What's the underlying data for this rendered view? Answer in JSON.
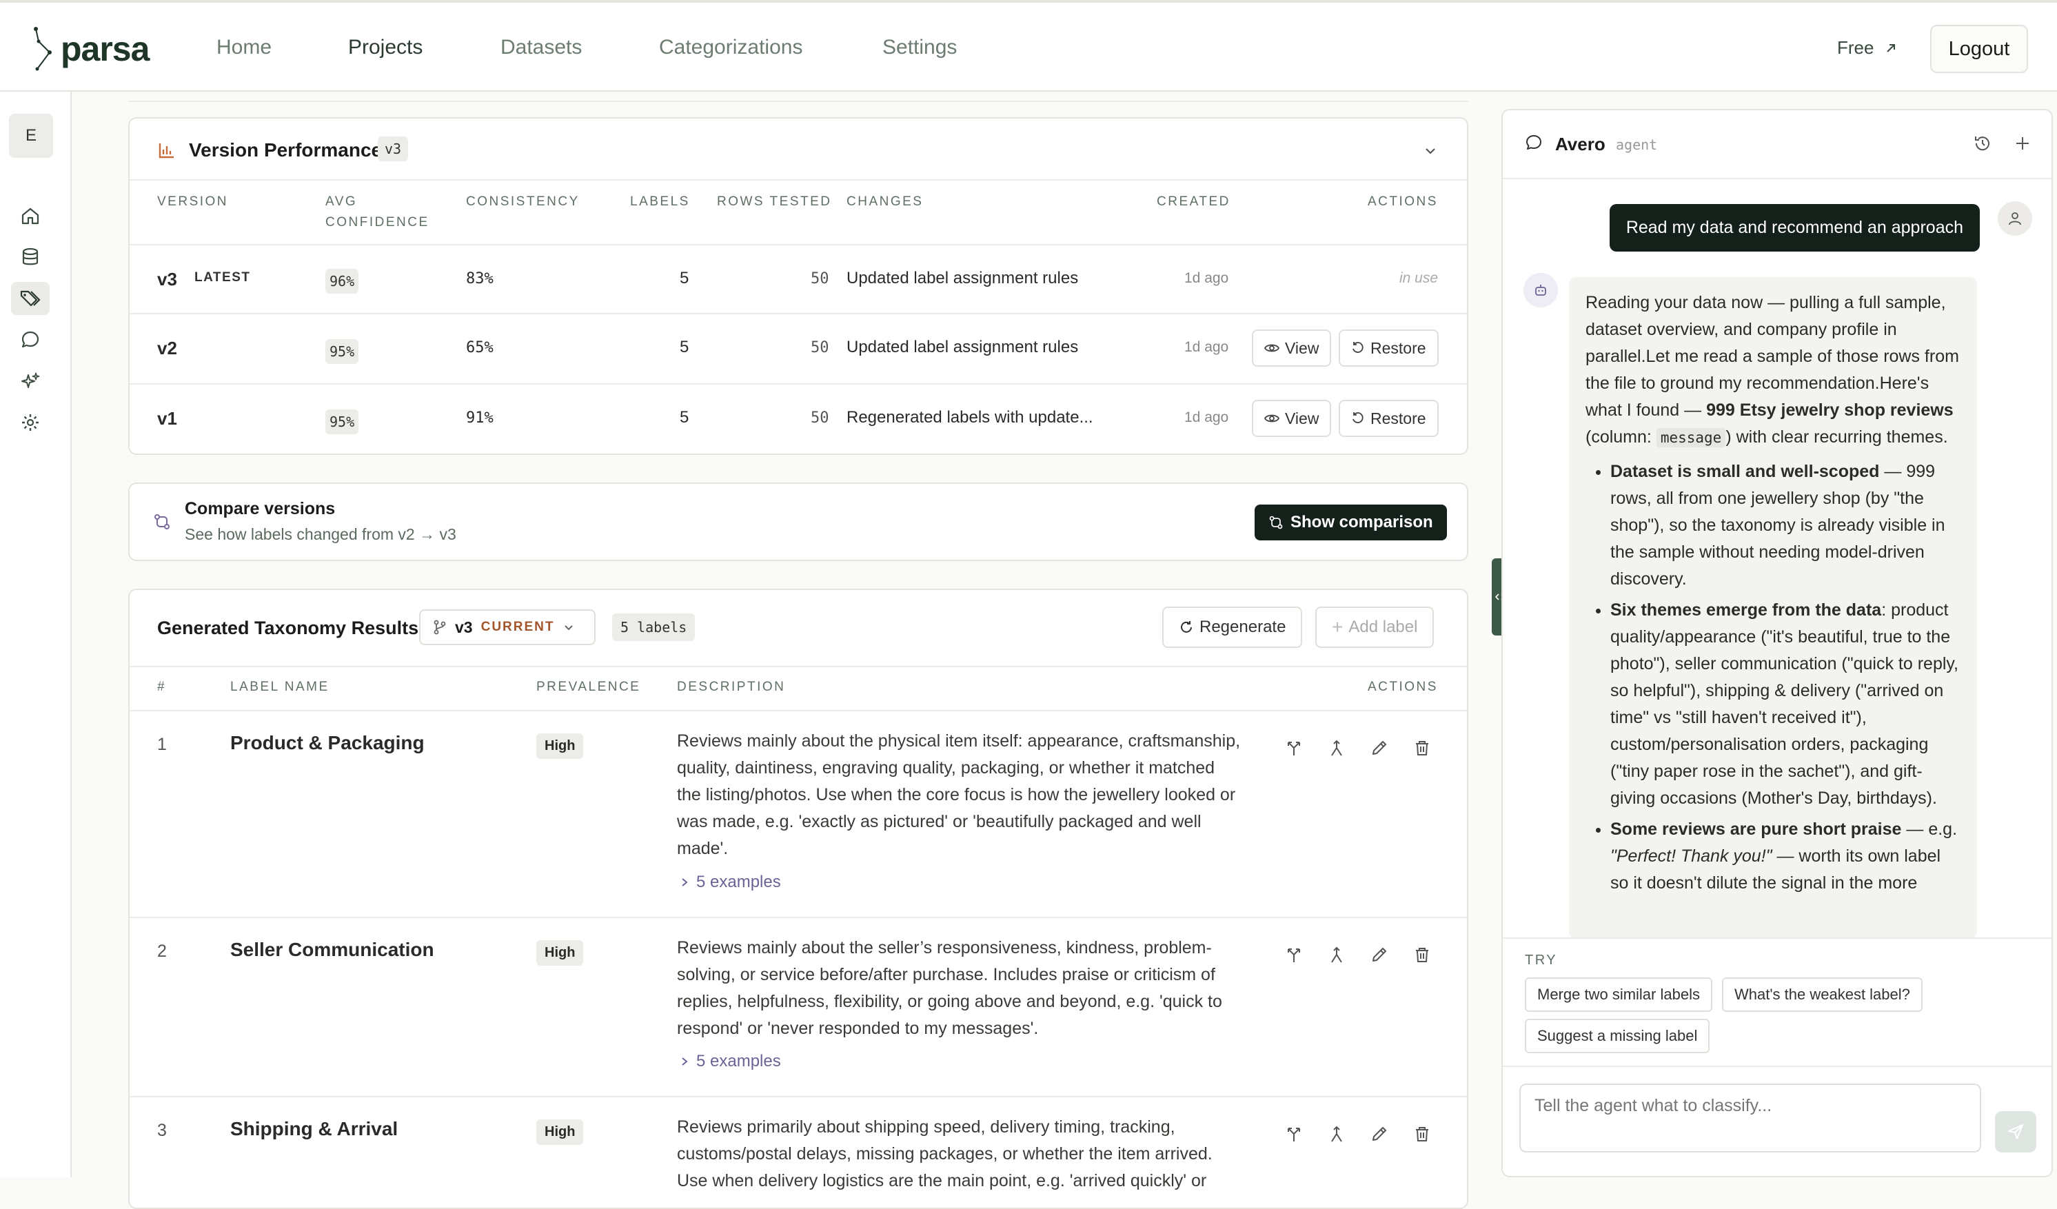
{
  "app": {
    "name": "parsa"
  },
  "nav": {
    "items": [
      "Home",
      "Projects",
      "Datasets",
      "Categorizations",
      "Settings"
    ],
    "free_label": "Free",
    "logout_label": "Logout"
  },
  "rail": {
    "avatar_letter": "E"
  },
  "version_performance": {
    "title": "Version Performance",
    "badge": "v3",
    "headers": [
      "VERSION",
      "AVG",
      "CONFIDENCE",
      "CONSISTENCY",
      "LABELS",
      "ROWS TESTED",
      "CHANGES",
      "CREATED",
      "ACTIONS"
    ],
    "rows": [
      {
        "version": "v3",
        "tag": "LATEST",
        "conf": "96%",
        "consistency": "83%",
        "labels": "5",
        "rows": "50",
        "changes": "Updated label assignment rules",
        "created": "1d ago",
        "status": "in use"
      },
      {
        "version": "v2",
        "tag": "",
        "conf": "95%",
        "consistency": "65%",
        "labels": "5",
        "rows": "50",
        "changes": "Updated label assignment rules",
        "created": "1d ago",
        "view": "View",
        "restore": "Restore"
      },
      {
        "version": "v1",
        "tag": "",
        "conf": "95%",
        "consistency": "91%",
        "labels": "5",
        "rows": "50",
        "changes": "Regenerated labels with update...",
        "created": "1d ago",
        "view": "View",
        "restore": "Restore"
      }
    ]
  },
  "compare": {
    "title": "Compare versions",
    "subtitle": "See how labels changed from v2 → v3",
    "button": "Show comparison"
  },
  "taxonomy": {
    "title": "Generated Taxonomy Results",
    "version": "v3",
    "version_tag": "CURRENT",
    "count": "5 labels",
    "regenerate": "Regenerate",
    "add_label": "Add label",
    "headers": [
      "#",
      "LABEL NAME",
      "PREVALENCE",
      "DESCRIPTION",
      "ACTIONS"
    ],
    "rows": [
      {
        "num": "1",
        "name": "Product & Packaging",
        "prevalence": "High",
        "lines": [
          "Reviews mainly about the physical item itself: appearance, craftsmanship,",
          "quality, daintiness, engraving quality, packaging, or whether it matched",
          "the listing/photos. Use when the core focus is how the jewellery looked or",
          "was made, e.g. 'exactly as pictured' or 'beautifully packaged and well",
          "made'."
        ],
        "examples": "5 examples"
      },
      {
        "num": "2",
        "name": "Seller Communication",
        "prevalence": "High",
        "lines": [
          "Reviews mainly about the seller’s responsiveness, kindness, problem-",
          "solving, or service before/after purchase. Includes praise or criticism of",
          "replies, helpfulness, flexibility, or going above and beyond, e.g. 'quick to",
          "respond' or 'never responded to my messages'."
        ],
        "examples": "5 examples"
      },
      {
        "num": "3",
        "name": "Shipping & Arrival",
        "prevalence": "High",
        "lines": [
          "Reviews primarily about shipping speed, delivery timing, tracking,",
          "customs/postal delays, missing packages, or whether the item arrived.",
          "Use when delivery logistics are the main point, e.g. 'arrived quickly' or"
        ]
      }
    ]
  },
  "agent": {
    "name": "Avero",
    "tag": "agent",
    "user_message": "Read my data and recommend an approach",
    "intro": "Reading your data now — pulling a full sample, dataset overview, and company profile in parallel.Let me read a sample of those rows from the file to ground my recommendation.Here's what I found — ",
    "intro_bold": "999 Etsy jewelry shop reviews",
    "intro_column_pre": " (column: ",
    "intro_column": "message",
    "intro_tail": ") with clear recurring themes.",
    "bullets": [
      {
        "bold": "Dataset is small and well-scoped",
        "text": " — 999 rows, all from one jewellery shop (by \"the shop\"), so the taxonomy is already visible in the sample without needing model-driven discovery."
      },
      {
        "bold": "Six themes emerge from the data",
        "text": ": product quality/appearance (\"it's beautiful, true to the photo\"), seller communication (\"quick to reply, so helpful\"), shipping & delivery (\"arrived on time\" vs \"still haven't received it\"), custom/personalisation orders, packaging (\"tiny paper rose in the sachet\"), and gift-giving occasions (Mother's Day, birthdays)."
      },
      {
        "bold": "Some reviews are pure short praise",
        "text": " — e.g. ",
        "italic": "\"Perfect! Thank you!\"",
        "tail": " — worth its own label so it doesn't dilute the signal in the more"
      }
    ],
    "try_label": "TRY",
    "suggestions": [
      "Merge two similar labels",
      "What's the weakest label?",
      "Suggest a missing label"
    ],
    "input_placeholder": "Tell the agent what to classify..."
  }
}
